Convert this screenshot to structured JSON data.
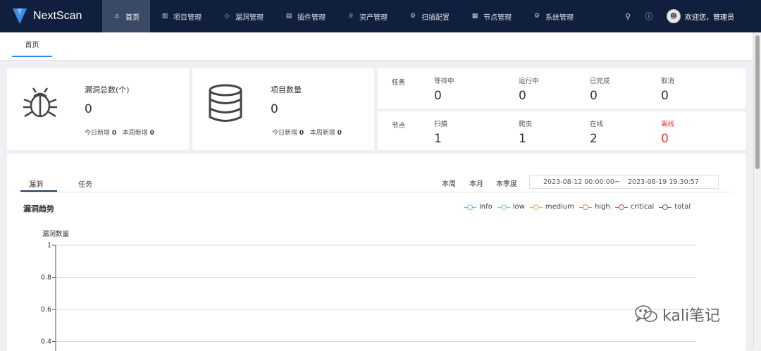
{
  "app": {
    "name": "NextScan"
  },
  "nav": {
    "items": [
      {
        "label": "首页",
        "icon": "home-icon",
        "glyph": "⌂"
      },
      {
        "label": "项目管理",
        "icon": "project-icon",
        "glyph": "▥"
      },
      {
        "label": "漏洞管理",
        "icon": "shield-icon",
        "glyph": "◇"
      },
      {
        "label": "插件管理",
        "icon": "file-icon",
        "glyph": "▤"
      },
      {
        "label": "资产管理",
        "icon": "crown-icon",
        "glyph": "♕"
      },
      {
        "label": "扫描配置",
        "icon": "gear-icon",
        "glyph": "⚙"
      },
      {
        "label": "节点管理",
        "icon": "document-icon",
        "glyph": "▦"
      },
      {
        "label": "系统管理",
        "icon": "settings-icon",
        "glyph": "⚙"
      }
    ]
  },
  "header": {
    "search_icon": "search-icon",
    "help_icon": "help-icon",
    "welcome": "欢迎您，管理员"
  },
  "tabs": {
    "home": "首页"
  },
  "stats": {
    "vuln": {
      "title": "漏洞总数(个)",
      "value": "0",
      "today_label": "今日新增",
      "today_value": "0",
      "week_label": "本周新增",
      "week_value": "0"
    },
    "project": {
      "title": "项目数量",
      "value": "0",
      "today_label": "今日新增",
      "today_value": "0",
      "week_label": "本周新增",
      "week_value": "0"
    }
  },
  "tasks": {
    "label": "任务",
    "cells": [
      {
        "label": "等待中",
        "value": "0"
      },
      {
        "label": "运行中",
        "value": "0"
      },
      {
        "label": "已完成",
        "value": "0"
      },
      {
        "label": "取消",
        "value": "0"
      }
    ]
  },
  "nodes": {
    "label": "节点",
    "cells": [
      {
        "label": "扫描",
        "value": "1"
      },
      {
        "label": "爬虫",
        "value": "1"
      },
      {
        "label": "在线",
        "value": "2"
      },
      {
        "label": "离线",
        "value": "0"
      }
    ]
  },
  "main": {
    "tabs": [
      "漏洞",
      "任务"
    ],
    "periods": [
      "本周",
      "本月",
      "本季度"
    ],
    "date_start": "2023-08-12 00:00:00",
    "date_sep": "~",
    "date_end": "2023-08-19 19:30:57"
  },
  "chart_data": {
    "type": "line",
    "title": "漏洞趋势",
    "ylabel": "漏洞数量",
    "yticks": [
      "1",
      "0.8",
      "0.6",
      "0.4"
    ],
    "ylim": [
      0,
      1
    ],
    "grid": true,
    "legend_position": "top-right",
    "series": [
      {
        "name": "info",
        "color": "#5bc0de",
        "values": []
      },
      {
        "name": "low",
        "color": "#66d3b4",
        "values": []
      },
      {
        "name": "medium",
        "color": "#f0ad4e",
        "values": []
      },
      {
        "name": "high",
        "color": "#f0784e",
        "values": []
      },
      {
        "name": "critical",
        "color": "#e0463c",
        "values": []
      },
      {
        "name": "total",
        "color": "#666666",
        "values": []
      }
    ]
  },
  "watermark": {
    "text": "kali笔记"
  }
}
